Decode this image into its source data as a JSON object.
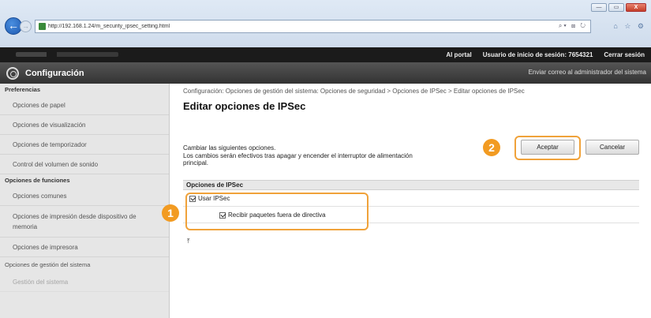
{
  "browser": {
    "url": "http://192.168.1.24/m_security_ipsec_setting.html",
    "window_buttons": [
      "—",
      "▭",
      "X"
    ]
  },
  "topbar": {
    "portal_link": "Al portal",
    "login_user": "Usuario de inicio de sesión:  7654321",
    "logout_link": "Cerrar sesión"
  },
  "header": {
    "title": "Configuración",
    "mail_admin": "Enviar correo al administrador del sistema"
  },
  "sidebar": {
    "section_preferences": "Preferencias",
    "items_preferences": [
      "Opciones de papel",
      "Opciones de visualización",
      "Opciones de temporizador",
      "Control del volumen de sonido"
    ],
    "section_functions": "Opciones de funciones",
    "items_functions": [
      "Opciones comunes",
      "Opciones de impresión desde dispositivo de memoria",
      "Opciones de impresora"
    ],
    "section_system": "Opciones de gestión del sistema",
    "item_system_partial": "Gestión del sistema"
  },
  "main": {
    "breadcrumb": "Configuración: Opciones de gestión del sistema: Opciones de seguridad > Opciones de IPSec > Editar opciones de IPSec",
    "title": "Editar opciones de IPSec",
    "desc_line1": "Cambiar las siguientes opciones.",
    "desc_line2": "Los cambios serán efectivos tras apagar y encender el interruptor de alimentación",
    "desc_line3": "principal.",
    "ok_button": "Aceptar",
    "cancel_button": "Cancelar",
    "section_title": "Opciones de IPSec",
    "opt_use_ipsec": "Usar IPSec",
    "opt_receive_nonpolicy": "Recibir paquetes fuera de directiva",
    "use_ipsec_checked": true,
    "receive_nonpolicy_checked": true,
    "to_top_icon": "to-top-icon"
  },
  "callouts": {
    "one": "1",
    "two": "2",
    "color": "#f29b22"
  }
}
